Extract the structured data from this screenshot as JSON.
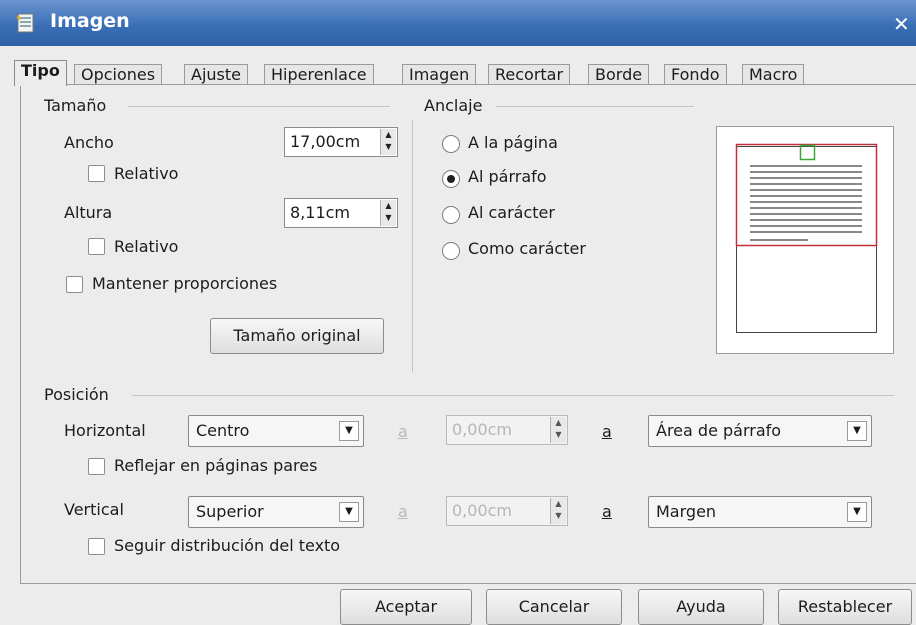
{
  "window": {
    "title": "Imagen"
  },
  "tabs": [
    "Tipo",
    "Opciones",
    "Ajuste",
    "Hiperenlace",
    "Imagen",
    "Recortar",
    "Borde",
    "Fondo",
    "Macro"
  ],
  "size": {
    "legend": "Tamaño",
    "width_label": "Ancho",
    "width_value": "17,00cm",
    "relative_label_1": "Relativo",
    "height_label": "Altura",
    "height_value": "8,11cm",
    "relative_label_2": "Relativo",
    "keep_ratio_label": "Mantener proporciones",
    "original_size_button": "Tamaño original"
  },
  "anchor": {
    "legend": "Anclaje",
    "options": [
      "A la página",
      "Al párrafo",
      "Al carácter",
      "Como carácter"
    ],
    "selected": "Al párrafo"
  },
  "position": {
    "legend": "Posición",
    "horizontal_label": "Horizontal",
    "horizontal_value": "Centro",
    "h_by_label": "a",
    "h_offset": "0,00cm",
    "h_to_label": "a",
    "h_to_value": "Área de párrafo",
    "mirror_label": "Reflejar en páginas pares",
    "vertical_label": "Vertical",
    "vertical_value": "Superior",
    "v_by_label": "a",
    "v_offset": "0,00cm",
    "v_to_label": "a",
    "v_to_value": "Margen",
    "follow_flow_label": "Seguir distribución del texto"
  },
  "buttons": {
    "ok": "Aceptar",
    "cancel": "Cancelar",
    "help": "Ayuda",
    "reset": "Restablecer"
  },
  "colors": {
    "titlebar": "#3a6fb6",
    "preview_frame": "#c0303a",
    "preview_anchor": "#3aa832"
  }
}
